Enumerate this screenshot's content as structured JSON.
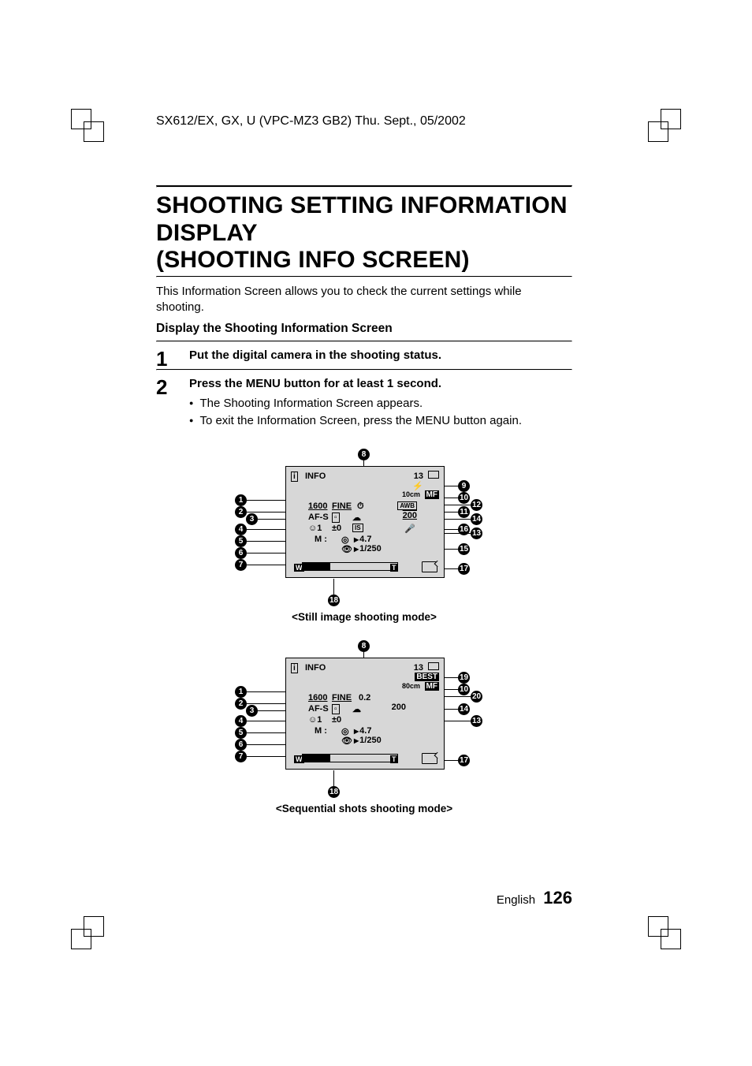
{
  "header": "SX612/EX, GX, U (VPC-MZ3 GB2)    Thu. Sept., 05/2002",
  "title_line1": "SHOOTING SETTING INFORMATION DISPLAY",
  "title_line2": "(SHOOTING INFO SCREEN)",
  "intro": "This Information Screen allows you to check the current settings while shooting.",
  "subhead": "Display the Shooting Information Screen",
  "steps": [
    {
      "num": "1",
      "title": "Put the digital camera in the shooting status."
    },
    {
      "num": "2",
      "title": "Press the MENU button for at least 1 second.",
      "bullets": [
        "The Shooting Information Screen appears.",
        "To exit the Information Screen, press the MENU button again."
      ]
    }
  ],
  "diagram1": {
    "caption": "<Still image shooting mode>",
    "screen": {
      "info_label": "INFO",
      "remaining": "13",
      "focus_dist": "10cm",
      "focus_mode": "MF",
      "resolution": "1600",
      "quality": "FINE",
      "af_mode": "AF-S",
      "iso": "200",
      "selftimer": "1",
      "ev": "±0",
      "exp_mode": "M",
      "aperture": "4.7",
      "shutter": "1/250",
      "zoom_w": "W",
      "zoom_t": "T"
    },
    "callouts_left": [
      "1",
      "2",
      "3",
      "4",
      "5",
      "6",
      "7"
    ],
    "callouts_top": [
      "8"
    ],
    "callouts_right": [
      "9",
      "10",
      "12",
      "11",
      "14",
      "16",
      "13",
      "15",
      "17"
    ],
    "callouts_bottom": [
      "18"
    ]
  },
  "diagram2": {
    "caption": "<Sequential shots shooting mode>",
    "screen": {
      "info_label": "INFO",
      "remaining": "13",
      "best": "BEST",
      "focus_dist": "80cm",
      "focus_mode": "MF",
      "resolution": "1600",
      "quality": "FINE",
      "interval": "0.2",
      "af_mode": "AF-S",
      "iso": "200",
      "selftimer": "1",
      "ev": "±0",
      "exp_mode": "M",
      "aperture": "4.7",
      "shutter": "1/250",
      "zoom_w": "W",
      "zoom_t": "T"
    },
    "callouts_left": [
      "1",
      "2",
      "3",
      "4",
      "5",
      "6",
      "7"
    ],
    "callouts_top": [
      "8"
    ],
    "callouts_right": [
      "19",
      "10",
      "20",
      "14",
      "13",
      "17"
    ],
    "callouts_bottom": [
      "18"
    ]
  },
  "footer_lang": "English",
  "footer_page": "126"
}
